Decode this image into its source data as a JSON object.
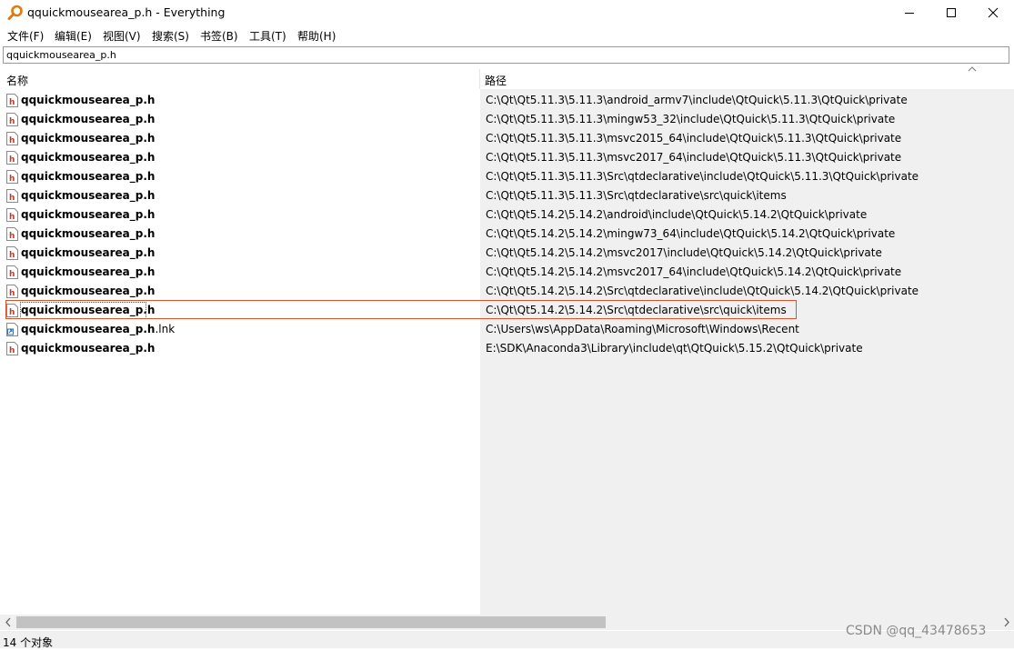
{
  "window": {
    "title": "qquickmousearea_p.h - Everything",
    "buttons": {
      "minimize": "—",
      "maximize": "☐",
      "close": "✕"
    }
  },
  "menu": [
    "文件(F)",
    "编辑(E)",
    "视图(V)",
    "搜索(S)",
    "书签(B)",
    "工具(T)",
    "帮助(H)"
  ],
  "search": {
    "value": "qquickmousearea_p.h"
  },
  "columns": {
    "name": "名称",
    "path": "路径"
  },
  "rows": [
    {
      "name": "qquickmousearea_p.h",
      "ext": "",
      "icon": "header-file-icon",
      "path": "C:\\Qt\\Qt5.11.3\\5.11.3\\android_armv7\\include\\QtQuick\\5.11.3\\QtQuick\\private"
    },
    {
      "name": "qquickmousearea_p.h",
      "ext": "",
      "icon": "header-file-icon",
      "path": "C:\\Qt\\Qt5.11.3\\5.11.3\\mingw53_32\\include\\QtQuick\\5.11.3\\QtQuick\\private"
    },
    {
      "name": "qquickmousearea_p.h",
      "ext": "",
      "icon": "header-file-icon",
      "path": "C:\\Qt\\Qt5.11.3\\5.11.3\\msvc2015_64\\include\\QtQuick\\5.11.3\\QtQuick\\private"
    },
    {
      "name": "qquickmousearea_p.h",
      "ext": "",
      "icon": "header-file-icon",
      "path": "C:\\Qt\\Qt5.11.3\\5.11.3\\msvc2017_64\\include\\QtQuick\\5.11.3\\QtQuick\\private"
    },
    {
      "name": "qquickmousearea_p.h",
      "ext": "",
      "icon": "header-file-icon",
      "path": "C:\\Qt\\Qt5.11.3\\5.11.3\\Src\\qtdeclarative\\include\\QtQuick\\5.11.3\\QtQuick\\private"
    },
    {
      "name": "qquickmousearea_p.h",
      "ext": "",
      "icon": "header-file-icon",
      "path": "C:\\Qt\\Qt5.11.3\\5.11.3\\Src\\qtdeclarative\\src\\quick\\items"
    },
    {
      "name": "qquickmousearea_p.h",
      "ext": "",
      "icon": "header-file-icon",
      "path": "C:\\Qt\\Qt5.14.2\\5.14.2\\android\\include\\QtQuick\\5.14.2\\QtQuick\\private"
    },
    {
      "name": "qquickmousearea_p.h",
      "ext": "",
      "icon": "header-file-icon",
      "path": "C:\\Qt\\Qt5.14.2\\5.14.2\\mingw73_64\\include\\QtQuick\\5.14.2\\QtQuick\\private"
    },
    {
      "name": "qquickmousearea_p.h",
      "ext": "",
      "icon": "header-file-icon",
      "path": "C:\\Qt\\Qt5.14.2\\5.14.2\\msvc2017\\include\\QtQuick\\5.14.2\\QtQuick\\private"
    },
    {
      "name": "qquickmousearea_p.h",
      "ext": "",
      "icon": "header-file-icon",
      "path": "C:\\Qt\\Qt5.14.2\\5.14.2\\msvc2017_64\\include\\QtQuick\\5.14.2\\QtQuick\\private"
    },
    {
      "name": "qquickmousearea_p.h",
      "ext": "",
      "icon": "header-file-icon",
      "path": "C:\\Qt\\Qt5.14.2\\5.14.2\\Src\\qtdeclarative\\include\\QtQuick\\5.14.2\\QtQuick\\private"
    },
    {
      "name": "qquickmousearea_p.h",
      "ext": "",
      "icon": "header-file-icon",
      "path": "C:\\Qt\\Qt5.14.2\\5.14.2\\Src\\qtdeclarative\\src\\quick\\items"
    },
    {
      "name": "qquickmousearea_p.h",
      "ext": ".lnk",
      "icon": "shortcut-file-icon",
      "path": "C:\\Users\\ws\\AppData\\Roaming\\Microsoft\\Windows\\Recent"
    },
    {
      "name": "qquickmousearea_p.h",
      "ext": "",
      "icon": "header-file-icon",
      "path": "E:\\SDK\\Anaconda3\\Library\\include\\qt\\QtQuick\\5.15.2\\QtQuick\\private"
    }
  ],
  "focused_row": 11,
  "status": {
    "text": "14 个对象"
  },
  "watermark": "CSDN @qq_43478653",
  "colors": {
    "highlight": "#d9532f",
    "app_icon": "#e07a10",
    "file_icon": "#c0392b"
  }
}
